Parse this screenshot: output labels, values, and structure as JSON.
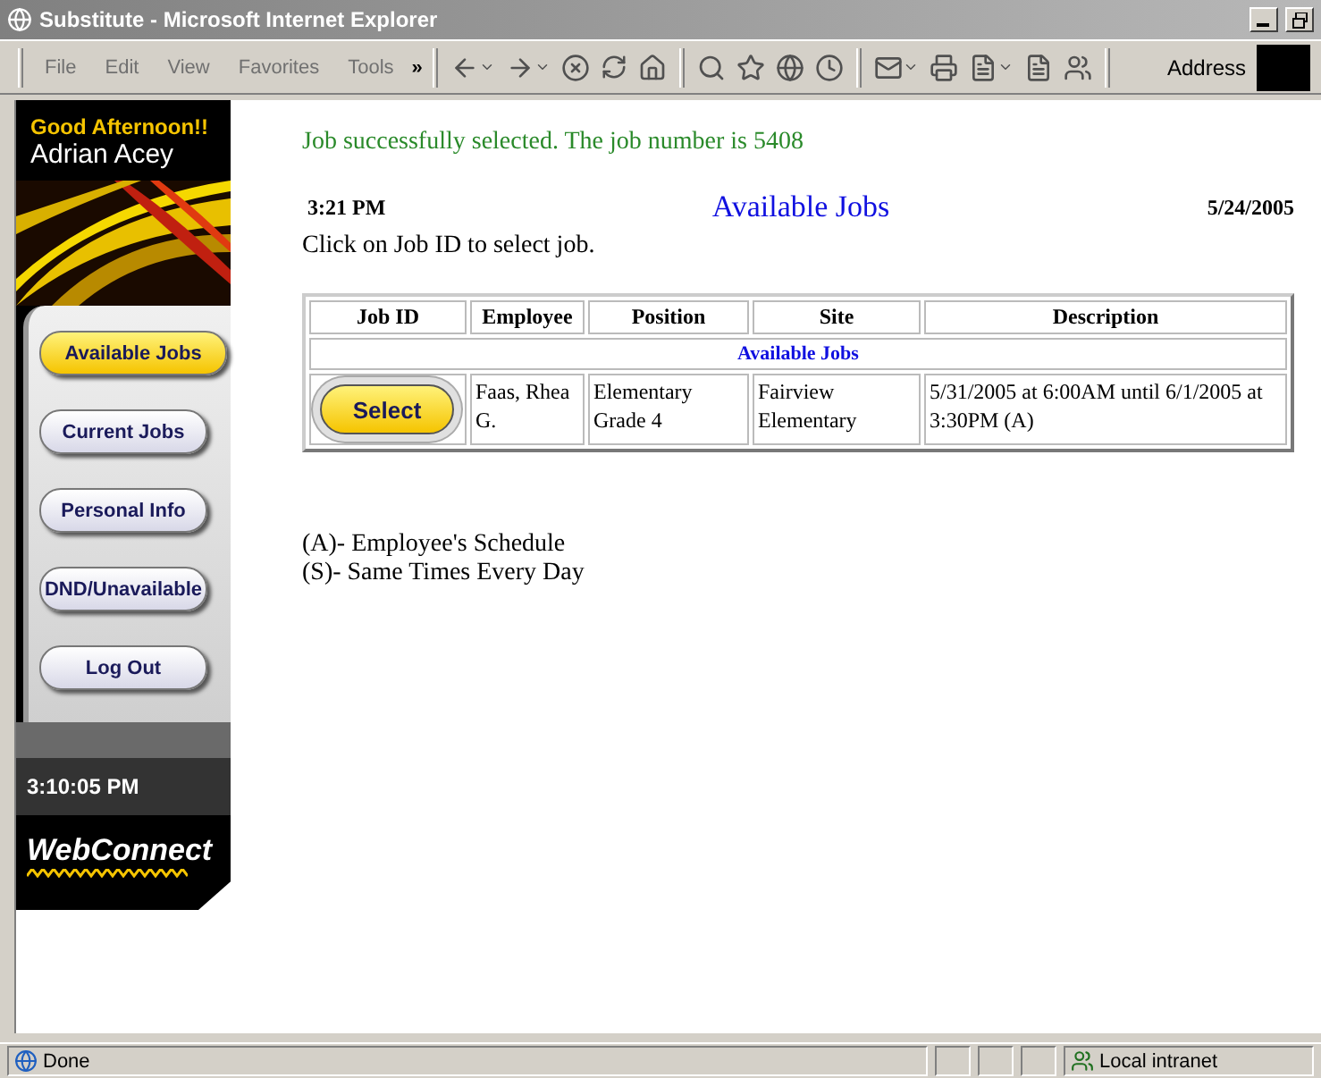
{
  "window": {
    "title": "Substitute - Microsoft Internet Explorer"
  },
  "menu": [
    "File",
    "Edit",
    "View",
    "Favorites",
    "Tools"
  ],
  "menu_overflow": "»",
  "address_label": "Address",
  "sidebar": {
    "greeting": "Good Afternoon!!",
    "user": "Adrian Acey",
    "items": [
      {
        "label": "Available Jobs",
        "selected": true
      },
      {
        "label": "Current Jobs",
        "selected": false
      },
      {
        "label": "Personal Info",
        "selected": false
      },
      {
        "label": "DND/Unavailable",
        "selected": false
      },
      {
        "label": "Log Out",
        "selected": false
      }
    ],
    "clock": "3:10:05 PM",
    "logo": "WebConnect"
  },
  "message": "Job successfully selected. The job number is 5408",
  "header": {
    "time": "3:21 PM",
    "title": "Available Jobs",
    "date": "5/24/2005"
  },
  "instruction": "Click on Job ID to select job.",
  "table": {
    "columns": [
      "Job ID",
      "Employee",
      "Position",
      "Site",
      "Description"
    ],
    "group": "Available Jobs",
    "rows": [
      {
        "action": "Select",
        "employee": "Faas, Rhea G.",
        "position": "Elementary Grade 4",
        "site": "Fairview Elementary",
        "description": "5/31/2005 at 6:00AM until 6/1/2005 at 3:30PM (A)"
      }
    ]
  },
  "legend": [
    "(A)- Employee's Schedule",
    "(S)- Same Times Every Day"
  ],
  "status_bar": {
    "text": "Done",
    "zone": "Local intranet"
  }
}
